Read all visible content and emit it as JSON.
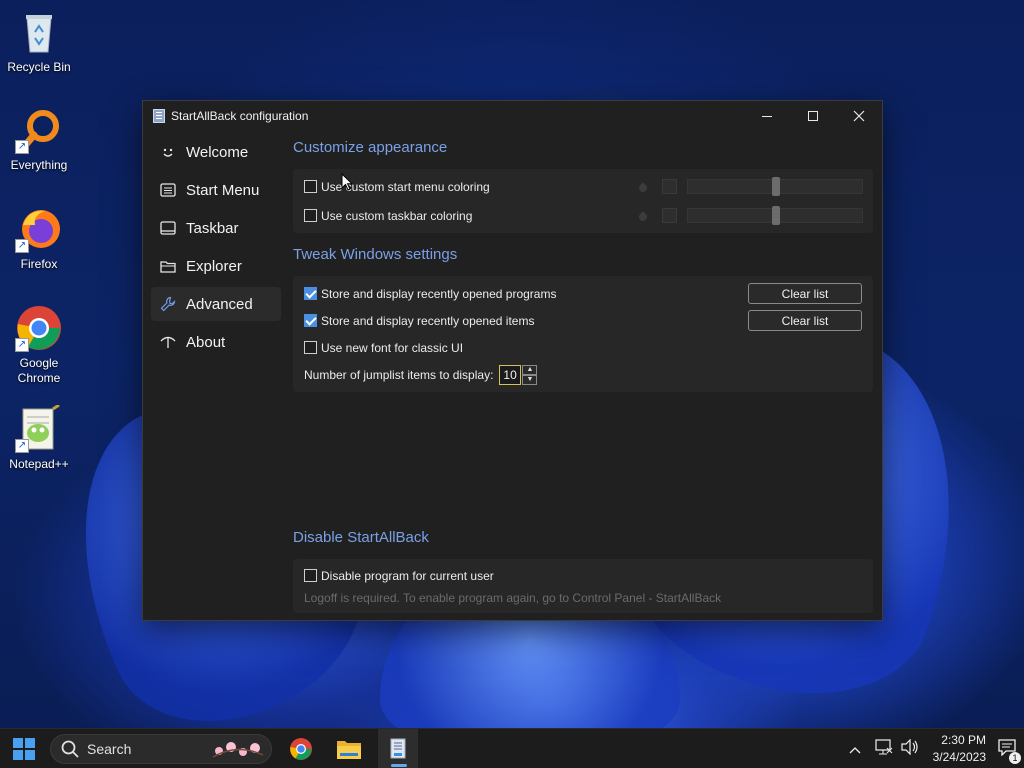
{
  "desktop": {
    "icons": [
      {
        "label": "Recycle Bin",
        "icon": "recycle-bin-icon"
      },
      {
        "label": "Everything",
        "icon": "everything-search-icon"
      },
      {
        "label": "Firefox",
        "icon": "firefox-icon"
      },
      {
        "label": "Google Chrome",
        "icon": "chrome-icon"
      },
      {
        "label": "Notepad++",
        "icon": "notepad-plus-plus-icon"
      }
    ]
  },
  "window": {
    "title": "StartAllBack configuration",
    "nav": [
      {
        "label": "Welcome",
        "icon": "smiley-icon",
        "active": false
      },
      {
        "label": "Start Menu",
        "icon": "start-menu-icon",
        "active": false
      },
      {
        "label": "Taskbar",
        "icon": "taskbar-icon",
        "active": false
      },
      {
        "label": "Explorer",
        "icon": "folder-icon",
        "active": false
      },
      {
        "label": "Advanced",
        "icon": "wrench-icon",
        "active": true
      },
      {
        "label": "About",
        "icon": "about-icon",
        "active": false
      }
    ],
    "appearance": {
      "title": "Customize appearance",
      "start_menu_coloring": {
        "label": "Use custom start menu coloring",
        "checked": false
      },
      "taskbar_coloring": {
        "label": "Use custom taskbar coloring",
        "checked": false
      }
    },
    "tweak": {
      "title": "Tweak Windows settings",
      "recent_programs": {
        "label": "Store and display recently opened programs",
        "checked": true,
        "button": "Clear list"
      },
      "recent_items": {
        "label": "Store and display recently opened items",
        "checked": true,
        "button": "Clear list"
      },
      "new_font": {
        "label": "Use new font for classic UI",
        "checked": false
      },
      "jumplist": {
        "label": "Number of jumplist items to display:",
        "value": "10"
      }
    },
    "disable": {
      "title": "Disable StartAllBack",
      "checkbox": {
        "label": "Disable program for current user",
        "checked": false
      },
      "hint": "Logoff is required. To enable program again, go to Control Panel - StartAllBack"
    }
  },
  "taskbar": {
    "search_label": "Search",
    "time": "2:30 PM",
    "date": "3/24/2023",
    "notification_count": "1",
    "accent": "#60a8f0"
  }
}
